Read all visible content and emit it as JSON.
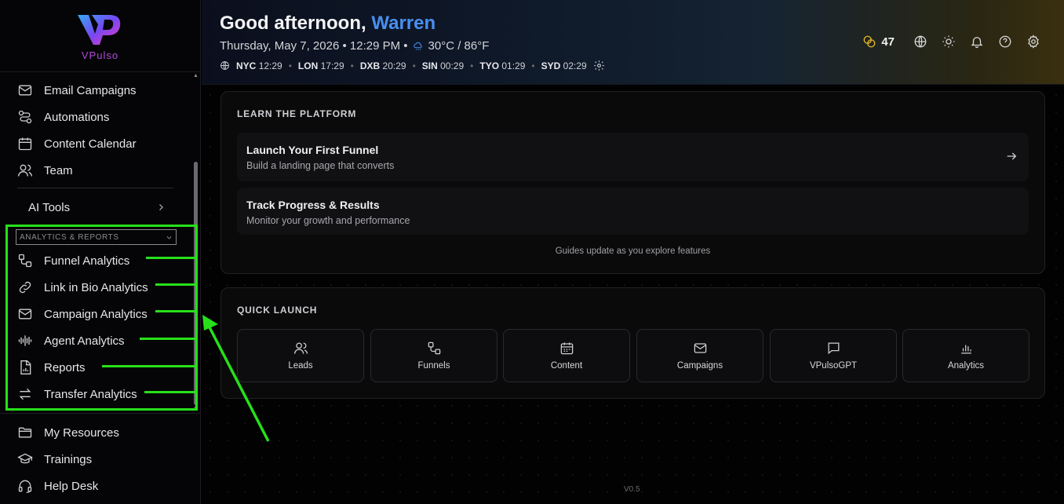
{
  "brand": {
    "name": "VPulso",
    "accent": "#b34ad9"
  },
  "sidebar": {
    "top_items": [
      {
        "label": "Email Campaigns",
        "icon": "mail-icon"
      },
      {
        "label": "Automations",
        "icon": "workflow-icon"
      },
      {
        "label": "Content Calendar",
        "icon": "calendar-icon"
      },
      {
        "label": "Team",
        "icon": "users-icon"
      }
    ],
    "ai_tools": "AI Tools",
    "section_header": "ANALYTICS & REPORTS",
    "analytics_items": [
      {
        "label": "Funnel Analytics",
        "icon": "funnel-nodes-icon"
      },
      {
        "label": "Link in Bio Analytics",
        "icon": "link-icon"
      },
      {
        "label": "Campaign Analytics",
        "icon": "mail-icon"
      },
      {
        "label": "Agent Analytics",
        "icon": "audio-wave-icon"
      },
      {
        "label": "Reports",
        "icon": "report-icon"
      },
      {
        "label": "Transfer Analytics",
        "icon": "transfer-icon"
      }
    ],
    "bottom_items": [
      {
        "label": "My Resources",
        "icon": "folder-icon"
      },
      {
        "label": "Trainings",
        "icon": "graduation-cap-icon"
      },
      {
        "label": "Help Desk",
        "icon": "headset-icon"
      }
    ]
  },
  "header": {
    "greeting": "Good afternoon,",
    "user_name": "Warren",
    "date": "Thursday, May 7, 2026 • 12:29 PM •",
    "weather": "30°C / 86°F",
    "clocks": [
      {
        "city": "NYC",
        "time": "12:29"
      },
      {
        "city": "LON",
        "time": "17:29"
      },
      {
        "city": "DXB",
        "time": "20:29"
      },
      {
        "city": "SIN",
        "time": "00:29"
      },
      {
        "city": "TYO",
        "time": "01:29"
      },
      {
        "city": "SYD",
        "time": "02:29"
      }
    ],
    "credits": "47"
  },
  "learn": {
    "title": "LEARN THE PLATFORM",
    "items": [
      {
        "title": "Launch Your First Funnel",
        "subtitle": "Build a landing page that converts"
      },
      {
        "title": "Track Progress & Results",
        "subtitle": "Monitor your growth and performance"
      }
    ],
    "note": "Guides update as you explore features"
  },
  "quick_launch": {
    "title": "QUICK LAUNCH",
    "items": [
      {
        "label": "Leads",
        "icon": "users-icon"
      },
      {
        "label": "Funnels",
        "icon": "funnel-nodes-icon"
      },
      {
        "label": "Content",
        "icon": "calendar-icon"
      },
      {
        "label": "Campaigns",
        "icon": "mail-icon"
      },
      {
        "label": "VPulsoGPT",
        "icon": "chat-icon"
      },
      {
        "label": "Analytics",
        "icon": "bar-chart-icon"
      }
    ]
  },
  "version": "V0.5",
  "colors": {
    "highlight": "#27e01a",
    "name_blue": "#4a8ff0",
    "credits_gold": "#e8b923"
  }
}
